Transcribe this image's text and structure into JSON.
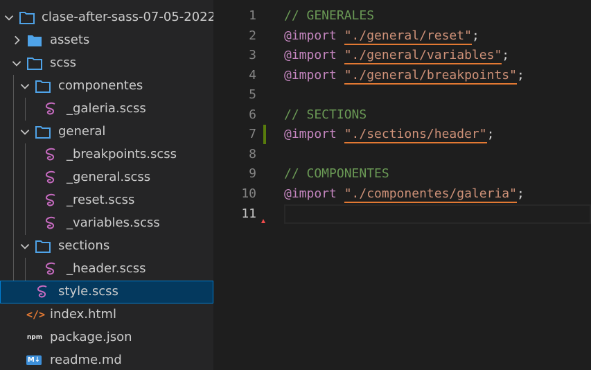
{
  "explorer": {
    "root_folder": "clase-after-sass-07-05-2022",
    "items": [
      {
        "label": "assets",
        "type": "folder",
        "expanded": false
      },
      {
        "label": "scss",
        "type": "folder",
        "expanded": true
      },
      {
        "label": "componentes",
        "type": "folder",
        "expanded": true
      },
      {
        "label": "_galeria.scss",
        "type": "scss-file"
      },
      {
        "label": "general",
        "type": "folder",
        "expanded": true
      },
      {
        "label": "_breakpoints.scss",
        "type": "scss-file"
      },
      {
        "label": "_general.scss",
        "type": "scss-file"
      },
      {
        "label": "_reset.scss",
        "type": "scss-file"
      },
      {
        "label": "_variables.scss",
        "type": "scss-file"
      },
      {
        "label": "sections",
        "type": "folder",
        "expanded": true
      },
      {
        "label": "_header.scss",
        "type": "scss-file"
      },
      {
        "label": "style.scss",
        "type": "scss-file",
        "selected": true
      },
      {
        "label": "index.html",
        "type": "html-file",
        "icon_text": "</>"
      },
      {
        "label": "package.json",
        "type": "npm-file",
        "icon_text": "npm"
      },
      {
        "label": "readme.md",
        "type": "md-file",
        "icon_text": "M↓"
      }
    ]
  },
  "editor": {
    "current_line": 11,
    "line_numbers": [
      "1",
      "2",
      "3",
      "4",
      "5",
      "6",
      "7",
      "8",
      "9",
      "10",
      "11"
    ],
    "lines": [
      {
        "comment": "// GENERALES"
      },
      {
        "keyword": "@import",
        "string": "\"./general/reset\"",
        "end": ";"
      },
      {
        "keyword": "@import",
        "string": "\"./general/variables\"",
        "end": ";"
      },
      {
        "keyword": "@import",
        "string": "\"./general/breakpoints\"",
        "end": ";"
      },
      {},
      {
        "comment": "// SECTIONS"
      },
      {
        "keyword": "@import",
        "string": "\"./sections/header\"",
        "end": ";"
      },
      {},
      {
        "comment": "// COMPONENTES"
      },
      {
        "keyword": "@import",
        "string": "\"./componentes/galeria\"",
        "end": ";"
      },
      {}
    ]
  },
  "colors": {
    "sidebar_bg": "#252526",
    "editor_bg": "#1e1e1e",
    "selection_bg": "#04395e",
    "folder_icon": "#4fa3e8",
    "sass_icon": "#c76bc0",
    "comment": "#6a9955",
    "keyword": "#c586c0",
    "string": "#ce9178",
    "link_underline": "#e37933",
    "modified_bar": "#587c0c"
  }
}
